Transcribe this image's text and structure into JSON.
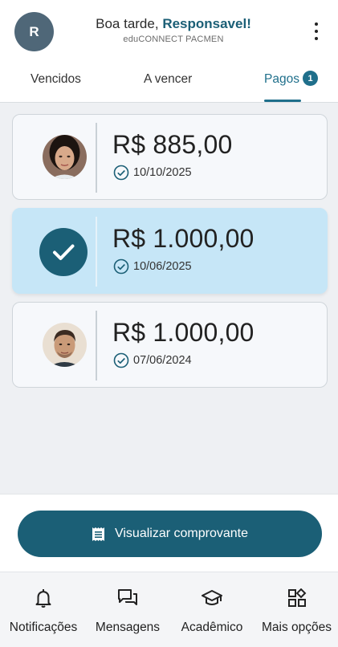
{
  "header": {
    "avatar_initial": "R",
    "greeting": "Boa tarde,",
    "user_name": "Responsavel!",
    "subtitle": "eduCONNECT PACMEN"
  },
  "tabs": [
    {
      "label": "Vencidos",
      "active": false
    },
    {
      "label": "A vencer",
      "active": false
    },
    {
      "label": "Pagos",
      "active": true,
      "badge": "1"
    }
  ],
  "payments": [
    {
      "amount": "R$ 885,00",
      "date": "10/10/2025",
      "selected": false,
      "avatar": "girl-photo"
    },
    {
      "amount": "R$ 1.000,00",
      "date": "10/06/2025",
      "selected": true,
      "avatar": "check-icon"
    },
    {
      "amount": "R$ 1.000,00",
      "date": "07/06/2024",
      "selected": false,
      "avatar": "man-photo"
    }
  ],
  "action_button": {
    "label": "Visualizar comprovante",
    "icon": "receipt-icon"
  },
  "bottom_nav": [
    {
      "label": "Notificações",
      "icon": "bell-icon"
    },
    {
      "label": "Mensagens",
      "icon": "chat-icon"
    },
    {
      "label": "Acadêmico",
      "icon": "graduation-cap-icon"
    },
    {
      "label": "Mais opções",
      "icon": "grid-icon"
    }
  ],
  "colors": {
    "accent": "#1b5f76",
    "selected_card": "#c6e6f7",
    "background": "#eef0f3"
  }
}
